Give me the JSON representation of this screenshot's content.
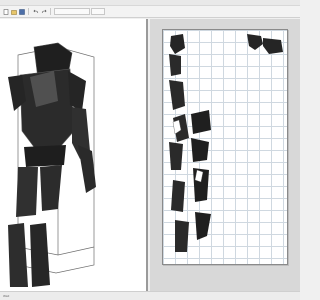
{
  "toolbar": {
    "buttons": [
      "new-icon",
      "open-icon",
      "save-icon",
      "undo-icon",
      "redo-icon",
      "select-icon",
      "move-icon",
      "rotate-icon",
      "zoom-icon"
    ],
    "field_one": "",
    "field_two": ""
  },
  "statusbar": {
    "left": "Wall",
    "right": ""
  },
  "colors": {
    "model_dark": "#2c2c2c",
    "model_light": "#6f6f6f",
    "sheet_grid": "#cfd8e0",
    "pane_bg": "#d8d8d8"
  }
}
